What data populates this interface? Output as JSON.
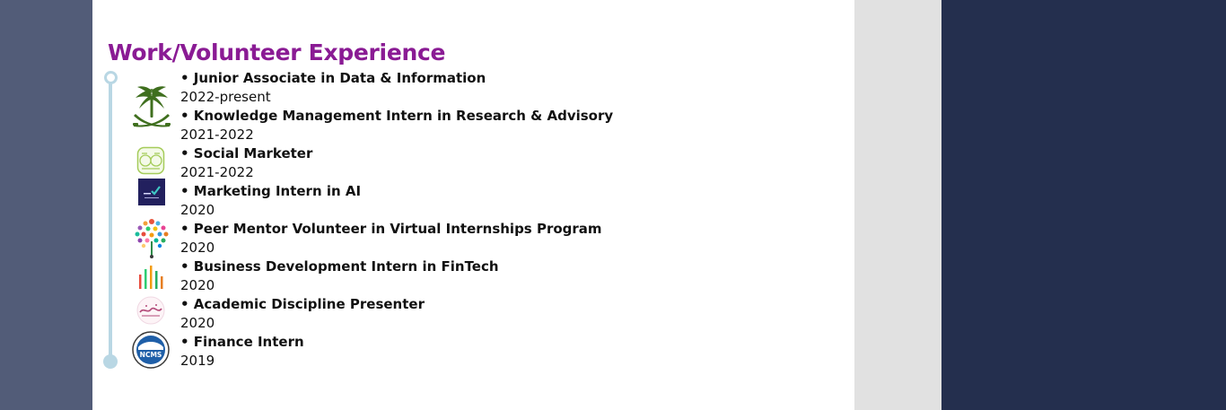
{
  "section": {
    "title": "Work/Volunteer Experience"
  },
  "entries": [
    {
      "role": "• Junior Associate in Data & Information",
      "dates": "2022-present"
    },
    {
      "role": "• Knowledge Management Intern in Research & Advisory",
      "dates": "2021-2022"
    },
    {
      "role": "• Social Marketer",
      "dates": "2021-2022"
    },
    {
      "role": "• Marketing Intern in AI",
      "dates": "2020"
    },
    {
      "role": "• Peer Mentor Volunteer in Virtual Internships Program",
      "dates": "2020"
    },
    {
      "role": "• Business Development Intern in FinTech",
      "dates": "2020"
    },
    {
      "role": "• Academic Discipline Presenter",
      "dates": "2020"
    },
    {
      "role": "• Finance Intern",
      "dates": "2019"
    }
  ],
  "logos": {
    "ncms_text": "NCMS"
  },
  "colors": {
    "title": "#8a1b94",
    "timeline": "#b9d7e4",
    "navy": "#242f4e",
    "slate": "#525c78"
  }
}
